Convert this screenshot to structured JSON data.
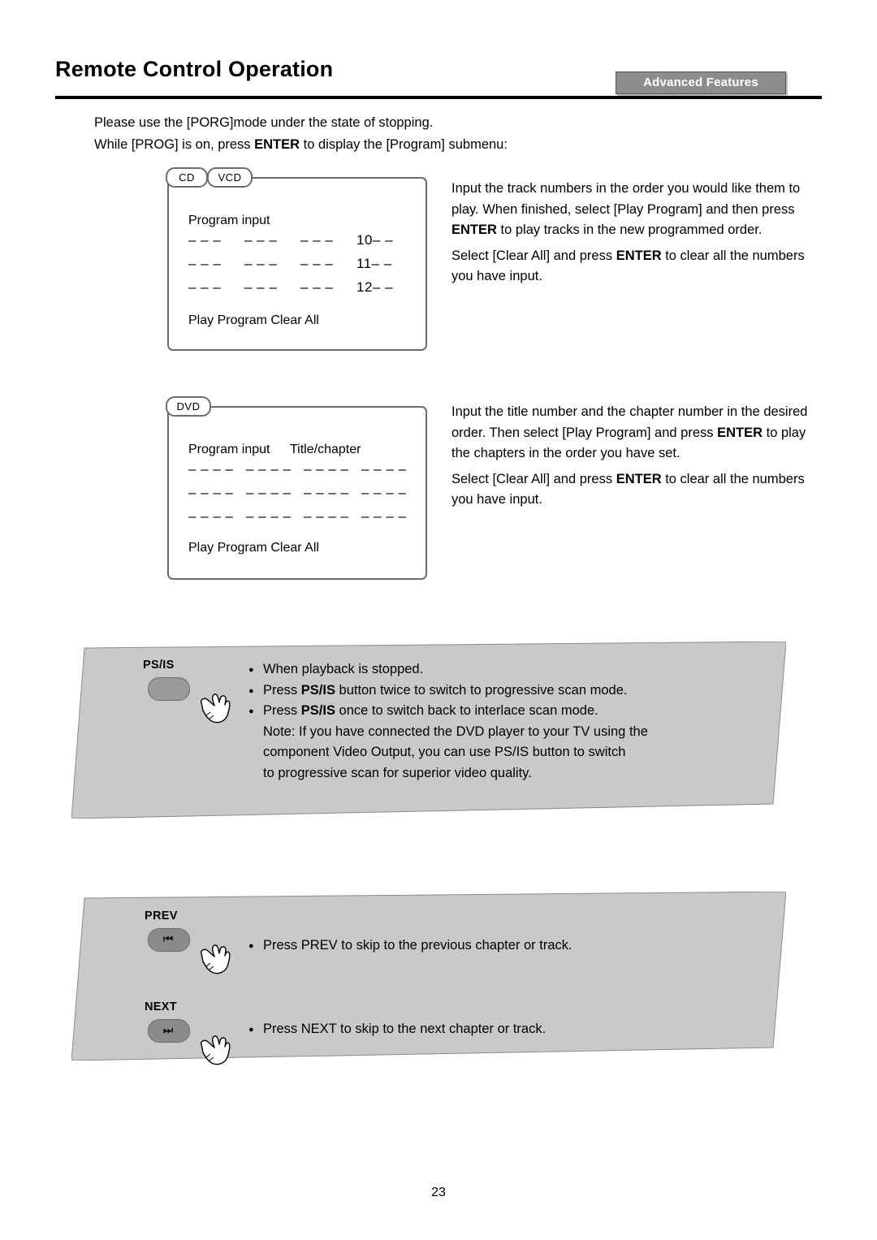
{
  "header": {
    "title": "Remote Control Operation",
    "tab_label": "Advanced Features"
  },
  "intro": {
    "line1": "Please use the [PORG]mode under the state of stopping.",
    "line2_a": "While [PROG] is on, press ",
    "line2_b": "ENTER",
    "line2_c": " to display the [Program] submenu:"
  },
  "osd_cd": {
    "tag_cd": "CD",
    "tag_vcd": "VCD",
    "heading": "Program input",
    "rows": [
      [
        "– – –",
        "– – –",
        "– – –",
        "10– –"
      ],
      [
        "– – –",
        "– – –",
        "– – –",
        "11– –"
      ],
      [
        "– – –",
        "– – –",
        "– – –",
        "12– –"
      ]
    ],
    "footer": "Play Program  Clear All"
  },
  "osd_dvd": {
    "tag_dvd": "DVD",
    "heading": "Program input",
    "heading2": "Title/chapter",
    "rows": [
      [
        "– – – –",
        "– – – –",
        "– – – –",
        "– – – –"
      ],
      [
        "– – – –",
        "– – – –",
        "– – – –",
        "– – – –"
      ],
      [
        "– – – –",
        "– – – –",
        "– – – –",
        "– – – –"
      ]
    ],
    "footer": "Play Program  Clear All"
  },
  "desc_cd": {
    "p1_a": "Input the track numbers in the order you would like them to play. When finished, select [Play Program] and then press ",
    "p1_b": "ENTER",
    "p1_c": " to play tracks in the new programmed order.",
    "p2_a": "Select [Clear All] and press ",
    "p2_b": "ENTER",
    "p2_c": " to clear all the numbers you have input."
  },
  "desc_dvd": {
    "p1_a": "Input the title number and the chapter number in the desired order. Then select [Play Program] and press ",
    "p1_b": "ENTER",
    "p1_c": " to play the chapters in the order you have set.",
    "p2_a": "Select [Clear All] and press ",
    "p2_b": "ENTER",
    "p2_c": " to clear all the numbers you have input."
  },
  "banner1": {
    "button_label": "PS/IS",
    "lines": [
      {
        "bullet": true,
        "a": "When playback is stopped.",
        "b": "",
        "c": ""
      },
      {
        "bullet": true,
        "a": "Press ",
        "b": "PS/IS",
        "c": " button twice to switch to progressive scan mode."
      },
      {
        "bullet": true,
        "a": "Press ",
        "b": "PS/IS",
        "c": " once to switch back to interlace scan mode."
      },
      {
        "bullet": false,
        "a": "Note: If you have connected the DVD player to your TV using the",
        "b": "",
        "c": ""
      },
      {
        "bullet": false,
        "a": "component Video Output, you can use PS/IS button to switch",
        "b": "",
        "c": ""
      },
      {
        "bullet": false,
        "a": "to progressive scan for superior video quality.",
        "b": "",
        "c": ""
      }
    ]
  },
  "banner2": {
    "prev_label": "PREV",
    "prev_glyph": "⏮",
    "prev_text": "Press PREV to skip to the previous chapter or track.",
    "next_label": "NEXT",
    "next_glyph": "⏭",
    "next_text": "Press NEXT to skip to the next chapter or track."
  },
  "footer": {
    "page_number": "23"
  }
}
